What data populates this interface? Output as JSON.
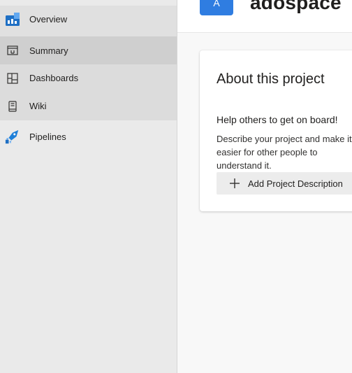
{
  "sidebar": {
    "items": [
      {
        "label": "Overview",
        "icon": "overview-icon"
      },
      {
        "label": "Summary",
        "icon": "summary-icon"
      },
      {
        "label": "Dashboards",
        "icon": "dashboards-icon"
      },
      {
        "label": "Wiki",
        "icon": "wiki-icon"
      },
      {
        "label": "Pipelines",
        "icon": "pipelines-icon"
      }
    ]
  },
  "header": {
    "avatar_letter": "A",
    "project_name": "adospace"
  },
  "about_card": {
    "title": "About this project",
    "subtitle": "Help others to get on board!",
    "description": "Describe your project and make it easier for other people to understand it.",
    "add_button_label": "Add Project Description"
  },
  "colors": {
    "accent": "#2f7de1",
    "overview_icon": "#1e6fc4",
    "pipelines_icon": "#1e7fd8"
  }
}
